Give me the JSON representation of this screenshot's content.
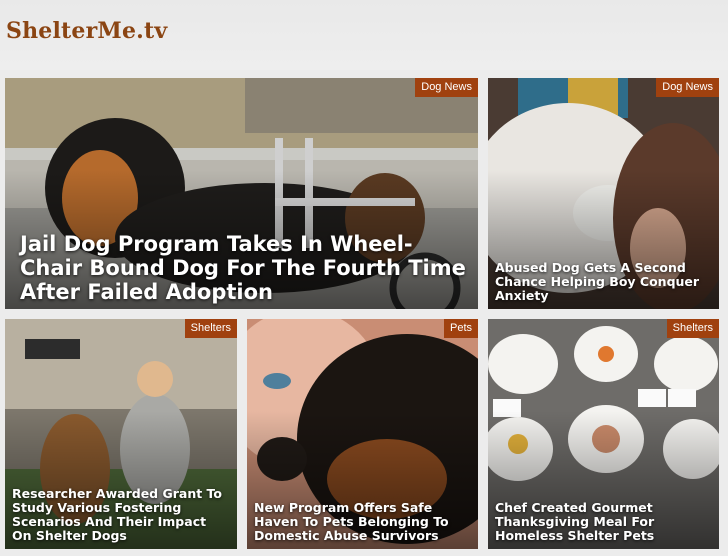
{
  "site": {
    "logo": "ShelterMe.tv"
  },
  "colors": {
    "logo": "#8b4513",
    "badge": "#a0410f"
  },
  "cards": [
    {
      "category": "Dog News",
      "title": "Jail Dog Program Takes In Wheel-Chair Bound Dog For The Fourth Time After Failed Adoption"
    },
    {
      "category": "Dog News",
      "title": "Abused Dog Gets A Second Chance Helping Boy Conquer Anxiety"
    },
    {
      "category": "Shelters",
      "title": "Researcher Awarded Grant To Study Various Fostering Scenarios And Their Impact On Shelter Dogs"
    },
    {
      "category": "Pets",
      "title": "New Program Offers Safe Haven To Pets Belonging To Domestic Abuse Survivors"
    },
    {
      "category": "Shelters",
      "title": "Chef Created Gourmet Thanksgiving Meal For Homeless Shelter Pets"
    }
  ]
}
